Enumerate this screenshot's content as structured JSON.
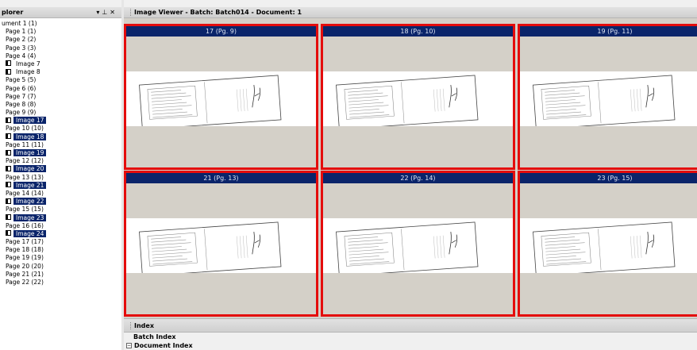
{
  "explorer": {
    "title": "plorer",
    "controls": {
      "pin": "▾",
      "autohide": "⊥",
      "close": "✕"
    },
    "tree": [
      {
        "type": "doc",
        "label": "ument 1 (1)"
      },
      {
        "type": "page",
        "label": "Page 1 (1)"
      },
      {
        "type": "page",
        "label": "Page 2 (2)"
      },
      {
        "type": "page",
        "label": "Page 3 (3)"
      },
      {
        "type": "page",
        "label": "Page 4 (4)"
      },
      {
        "type": "image",
        "label": "Image 7",
        "selected": false
      },
      {
        "type": "image",
        "label": "Image 8",
        "selected": false
      },
      {
        "type": "page",
        "label": "Page 5 (5)"
      },
      {
        "type": "page",
        "label": "Page 6 (6)"
      },
      {
        "type": "page",
        "label": "Page 7 (7)"
      },
      {
        "type": "page",
        "label": "Page 8 (8)"
      },
      {
        "type": "page",
        "label": "Page 9 (9)"
      },
      {
        "type": "image",
        "label": "Image 17",
        "selected": true
      },
      {
        "type": "page",
        "label": "Page 10 (10)"
      },
      {
        "type": "image",
        "label": "Image 18",
        "selected": true
      },
      {
        "type": "page",
        "label": "Page 11 (11)"
      },
      {
        "type": "image",
        "label": "Image 19",
        "selected": true
      },
      {
        "type": "page",
        "label": "Page 12 (12)"
      },
      {
        "type": "image",
        "label": "Image 20",
        "selected": true
      },
      {
        "type": "page",
        "label": "Page 13 (13)"
      },
      {
        "type": "image",
        "label": "Image 21",
        "selected": true
      },
      {
        "type": "page",
        "label": "Page 14 (14)"
      },
      {
        "type": "image",
        "label": "Image 22",
        "selected": true
      },
      {
        "type": "page",
        "label": "Page 15 (15)"
      },
      {
        "type": "image",
        "label": "Image 23",
        "selected": true
      },
      {
        "type": "page",
        "label": "Page 16 (16)"
      },
      {
        "type": "image",
        "label": "Image 24",
        "selected": true
      },
      {
        "type": "page",
        "label": "Page 17 (17)"
      },
      {
        "type": "page",
        "label": "Page 18 (18)"
      },
      {
        "type": "page",
        "label": "Page 19 (19)"
      },
      {
        "type": "page",
        "label": "Page 20 (20)"
      },
      {
        "type": "page",
        "label": "Page 21 (21)"
      },
      {
        "type": "page",
        "label": "Page 22 (22)"
      }
    ]
  },
  "viewer": {
    "title": "Image Viewer - Batch: Batch014 - Document: 1",
    "thumbnails": [
      {
        "label": "17 (Pg. 9)"
      },
      {
        "label": "18 (Pg. 10)"
      },
      {
        "label": "19 (Pg. 11)"
      },
      {
        "label": "21 (Pg. 13)"
      },
      {
        "label": "22 (Pg. 14)"
      },
      {
        "label": "23 (Pg. 15)"
      }
    ]
  },
  "index_panel": {
    "title": "Index",
    "batch_index": "Batch Index",
    "document_index": "Document Index",
    "document_index_toggle": "−"
  },
  "colors": {
    "selection": "#0a246a",
    "thumb_border": "#e40c0c",
    "thumb_background": "#d4d0c8"
  }
}
